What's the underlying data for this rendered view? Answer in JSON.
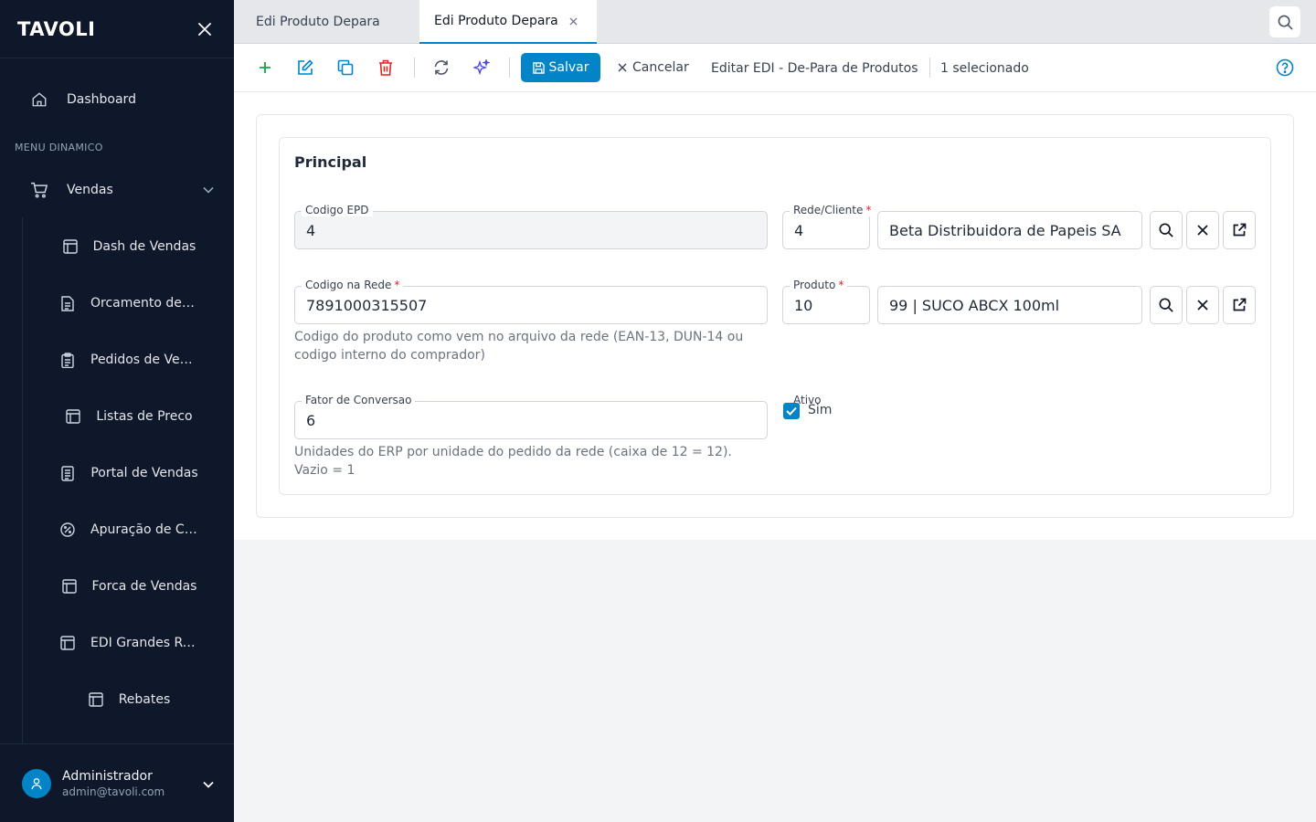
{
  "sidebar": {
    "brand": "TAVOLI",
    "dashboard": "Dashboard",
    "section_label": "MENU DINAMICO",
    "group": "Vendas",
    "items": [
      {
        "label": "Dash de Vendas",
        "icon": "layout-icon"
      },
      {
        "label": "Orcamento de Vendas",
        "icon": "document-icon"
      },
      {
        "label": "Pedidos de Venda",
        "icon": "clipboard-icon"
      },
      {
        "label": "Listas de Preco",
        "icon": "layout-icon"
      },
      {
        "label": "Portal de Vendas",
        "icon": "document-icon"
      },
      {
        "label": "Apuração de Comissões",
        "icon": "percent-icon"
      },
      {
        "label": "Forca de Vendas",
        "icon": "layout-icon"
      },
      {
        "label": "EDI Grandes Redes",
        "icon": "layout-icon"
      },
      {
        "label": "Rebates",
        "icon": "layout-icon"
      }
    ],
    "user": {
      "name": "Administrador",
      "email": "admin@tavoli.com"
    }
  },
  "tabs": [
    {
      "label": "Edi Produto Depara",
      "active": false
    },
    {
      "label": "Edi Produto Depara",
      "active": true
    }
  ],
  "toolbar": {
    "save_label": "Salvar",
    "cancel_label": "Cancelar",
    "title": "Editar EDI - De-Para de Produtos",
    "selection": "1 selecionado"
  },
  "form": {
    "section_title": "Principal",
    "codigo_epd": {
      "label": "Codigo EPD",
      "value": "4"
    },
    "rede_cliente": {
      "label": "Rede/Cliente",
      "code": "4",
      "name": "Beta Distribuidora de Papeis SA"
    },
    "codigo_rede": {
      "label": "Codigo na Rede",
      "value": "7891000315507",
      "hint_1": "Codigo do produto como vem no arquivo da rede (EAN-13, DUN-14 ou",
      "hint_2": "codigo interno do comprador)"
    },
    "produto": {
      "label": "Produto",
      "code": "10",
      "name": "99 | SUCO ABCX 100ml"
    },
    "fator": {
      "label": "Fator de Conversao",
      "value": "6",
      "hint_1": "Unidades do ERP por unidade do pedido da rede (caixa de 12 = 12).",
      "hint_2": "Vazio = 1"
    },
    "ativo": {
      "label": "Ativo",
      "option": "Sim",
      "checked": true
    }
  },
  "colors": {
    "accent": "#0284c7",
    "sidebar_bg": "#0f172a",
    "danger": "#dc2626",
    "success": "#16a34a"
  }
}
